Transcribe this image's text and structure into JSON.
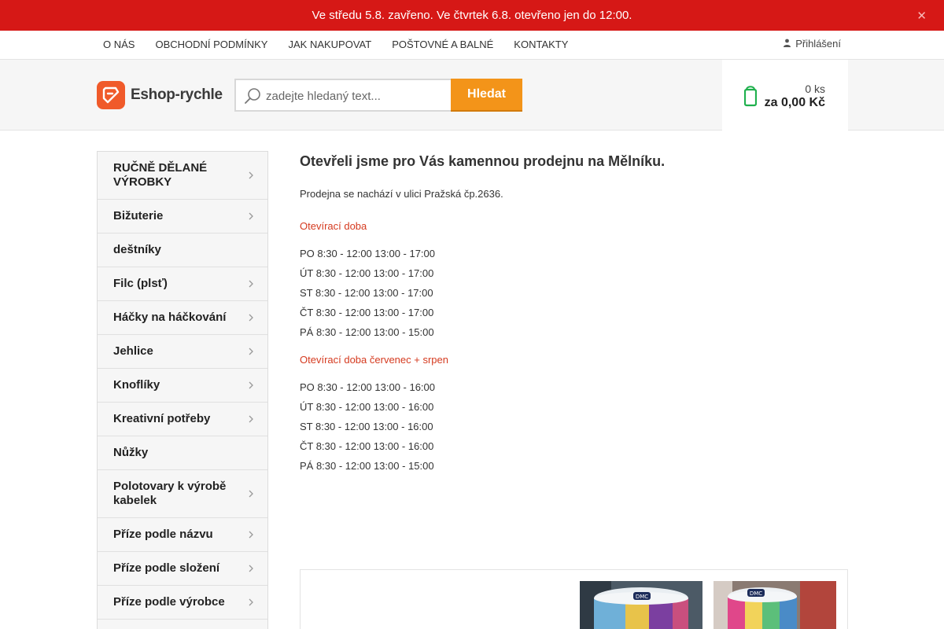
{
  "announcement": {
    "text": "Ve středu 5.8. zavřeno. Ve čtvrtek 6.8. otevřeno jen do 12:00.",
    "close_icon": "close-icon"
  },
  "nav": {
    "links": [
      "O NÁS",
      "OBCHODNÍ PODMÍNKY",
      "JAK NAKUPOVAT",
      "POŠTOVNÉ A BALNÉ",
      "KONTAKTY"
    ],
    "login_label": "Přihlášení"
  },
  "header": {
    "logo_text": "Eshop-rychle",
    "search": {
      "placeholder": "zadejte hledaný text...",
      "value": "",
      "button_label": "Hledat"
    },
    "cart": {
      "quantity": "0 ks",
      "total": "za 0,00 Kč"
    }
  },
  "sidebar": {
    "items": [
      {
        "label": "RUČNĚ DĚLANÉ VÝROBKY",
        "has_children": true
      },
      {
        "label": "Bižuterie",
        "has_children": true
      },
      {
        "label": "deštníky",
        "has_children": false
      },
      {
        "label": "Filc (plsť)",
        "has_children": true
      },
      {
        "label": "Háčky na háčkování",
        "has_children": true
      },
      {
        "label": "Jehlice",
        "has_children": true
      },
      {
        "label": "Knoflíky",
        "has_children": true
      },
      {
        "label": "Kreativní potřeby",
        "has_children": true
      },
      {
        "label": "Nůžky",
        "has_children": false
      },
      {
        "label": "Polotovary k výrobě kabelek",
        "has_children": true
      },
      {
        "label": "Příze podle názvu",
        "has_children": true
      },
      {
        "label": "Příze podle složení",
        "has_children": true
      },
      {
        "label": "Příze podle výrobce",
        "has_children": true
      }
    ]
  },
  "content": {
    "title": "Otevřeli jsme pro Vás kamennou prodejnu na Mělníku.",
    "location": "Prodejna se nachází v ulici Pražská čp.2636.",
    "hours_heading": "Otevírací doba",
    "hours": [
      "PO 8:30 - 12:00 13:00 - 17:00",
      "ÚT 8:30 - 12:00 13:00 - 17:00",
      "ST 8:30 - 12:00 13:00 - 17:00",
      "ČT 8:30 - 12:00 13:00 - 17:00",
      "PÁ 8:30 - 12:00 13:00 - 15:00"
    ],
    "summer_heading": "Otevírací doba červenec + srpen",
    "summer_hours": [
      "PO 8:30 - 12:00 13:00 - 16:00",
      "ÚT 8:30 - 12:00 13:00 - 16:00",
      "ST 8:30 - 12:00 13:00 - 16:00",
      "ČT 8:30 - 12:00 13:00 - 16:00",
      "PÁ 8:30 - 12:00 13:00 - 15:00"
    ]
  },
  "colors": {
    "announcement_bg": "#d61816",
    "search_button": "#f39419",
    "cart_icon": "#1fb04d",
    "accent_red_text": "#d53a1f",
    "logo_mark": "#f05a2a"
  }
}
